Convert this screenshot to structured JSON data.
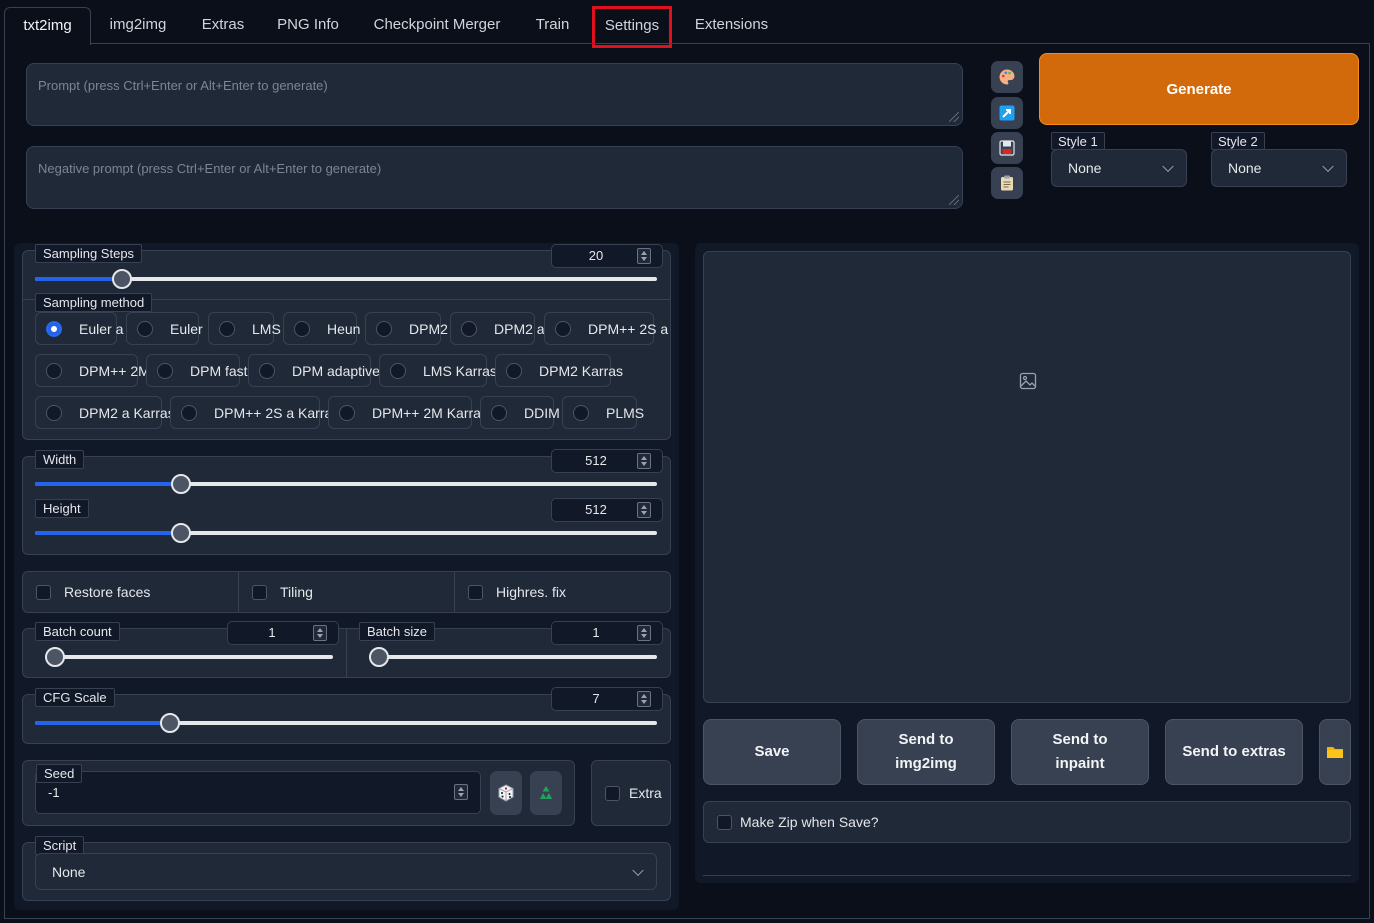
{
  "tabs": [
    {
      "label": "txt2img",
      "active": true
    },
    {
      "label": "img2img"
    },
    {
      "label": "Extras"
    },
    {
      "label": "PNG Info"
    },
    {
      "label": "Checkpoint Merger"
    },
    {
      "label": "Train"
    },
    {
      "label": "Settings",
      "highlighted": true
    },
    {
      "label": "Extensions"
    }
  ],
  "prompt": {
    "placeholder": "Prompt (press Ctrl+Enter or Alt+Enter to generate)"
  },
  "negative_prompt": {
    "placeholder": "Negative prompt (press Ctrl+Enter or Alt+Enter to generate)"
  },
  "toolbar_icons": [
    "palette-icon",
    "arrow-icon",
    "save-icon",
    "clipboard-icon"
  ],
  "generate": {
    "label": "Generate"
  },
  "style1": {
    "label": "Style 1",
    "value": "None"
  },
  "style2": {
    "label": "Style 2",
    "value": "None"
  },
  "sampling_steps": {
    "label": "Sampling Steps",
    "value": "20",
    "fraction": 0.14
  },
  "sampling_method": {
    "label": "Sampling method",
    "options": [
      "Euler a",
      "Euler",
      "LMS",
      "Heun",
      "DPM2",
      "DPM2 a",
      "DPM++ 2S a",
      "DPM++ 2M",
      "DPM fast",
      "DPM adaptive",
      "LMS Karras",
      "DPM2 Karras",
      "DPM2 a Karras",
      "DPM++ 2S a Karras",
      "DPM++ 2M Karras",
      "DDIM",
      "PLMS"
    ],
    "selected": "Euler a"
  },
  "width": {
    "label": "Width",
    "value": "512",
    "fraction": 0.234
  },
  "height": {
    "label": "Height",
    "value": "512",
    "fraction": 0.234
  },
  "restore_faces": {
    "label": "Restore faces"
  },
  "tiling": {
    "label": "Tiling"
  },
  "highres_fix": {
    "label": "Highres. fix"
  },
  "batch_count": {
    "label": "Batch count",
    "value": "1",
    "fraction": 0
  },
  "batch_size": {
    "label": "Batch size",
    "value": "1",
    "fraction": 0
  },
  "cfg_scale": {
    "label": "CFG Scale",
    "value": "7",
    "fraction": 0.217
  },
  "seed": {
    "label": "Seed",
    "value": "-1"
  },
  "extra": {
    "label": "Extra"
  },
  "script": {
    "label": "Script",
    "value": "None"
  },
  "output_buttons": {
    "save": "Save",
    "send_img2img_1": "Send to",
    "send_img2img_2": "img2img",
    "send_inpaint_1": "Send to",
    "send_inpaint_2": "inpaint",
    "send_extras": "Send to extras"
  },
  "make_zip": {
    "label": "Make Zip when Save?"
  },
  "colors": {
    "accent": "#2563eb",
    "generate": "#d26a0b",
    "background": "#0b0f19",
    "panel": "#1f2937",
    "highlight_box": "#e0101e"
  }
}
